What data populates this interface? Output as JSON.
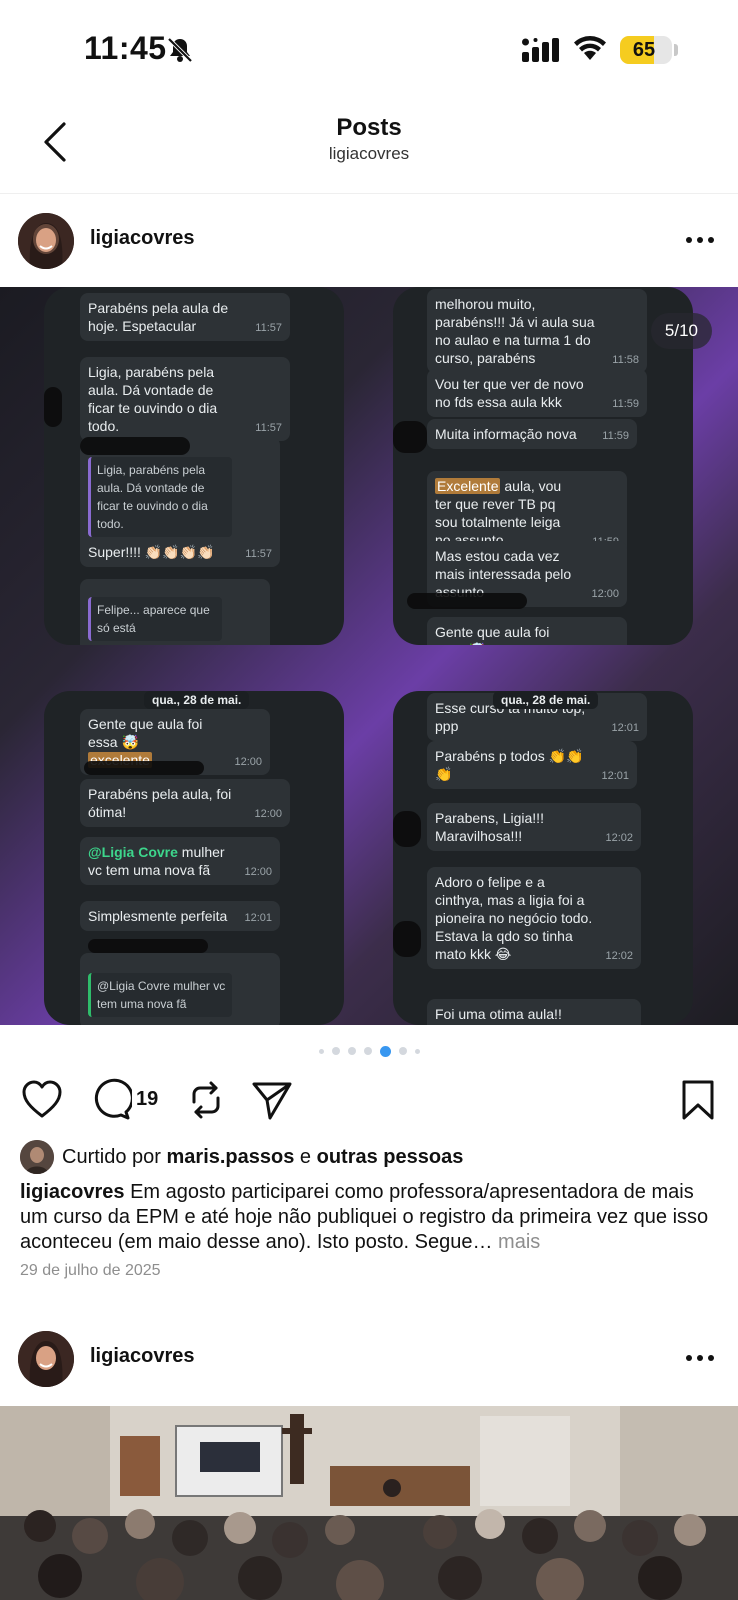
{
  "status_bar": {
    "time": "11:45",
    "battery": "65",
    "battery_level": 0.65
  },
  "header": {
    "title": "Posts",
    "subtitle": "ligiacovres"
  },
  "post1": {
    "username": "ligiacovres",
    "counter": "5/10",
    "chat": {
      "p1": {
        "b1": "Parabéns pela aula de hoje. Espetacular",
        "b1_time": "11:57",
        "b2": "Ligia, parabéns pela aula. Dá vontade de ficar te ouvindo o dia todo.",
        "b2_time": "11:57",
        "b3_quote": "Ligia, parabéns pela aula. Dá vontade de ficar te ouvindo o dia todo.",
        "b3": "Super!!!! 👏🏻👏🏻👏🏻👏🏻",
        "b3_time": "11:57",
        "b4_quote": "Felipe... aparece que só está"
      },
      "p2": {
        "b1": "melhorou muito, parabéns!!! Já vi aula sua no aulao e na turma 1 do curso, parabéns",
        "b1_time": "11:58",
        "b2": "Vou ter que ver de novo no fds essa aula kkk",
        "b2_time": "11:59",
        "b3": "Muita informação nova",
        "b3_time": "11:59",
        "b4_hl": "Excelente",
        "b4": " aula, vou ter que rever TB pq sou totalmente leiga no assunto",
        "b4_time": "11:59",
        "b5": "Mas estou cada vez mais interessada pelo assunto",
        "b5_time": "12:00",
        "b6": "Gente que aula foi essa 🤯"
      },
      "p3": {
        "date": "qua., 28 de mai.",
        "b1": "Gente que aula foi essa 🤯",
        "b1_hl": "excelente",
        "b1_time": "12:00",
        "b2": "Parabéns pela aula, foi ótima!",
        "b2_time": "12:00",
        "b3_mention": "@Ligia Covre",
        "b3": " mulher vc tem uma nova fã",
        "b3_time": "12:00",
        "b4": "Simplesmente perfeita",
        "b4_time": "12:01",
        "b5_quote": "@Ligia Covre mulher vc tem uma nova fã"
      },
      "p4": {
        "date": "qua., 28 de mai.",
        "b1": "Esse curso tá muito top, ppp",
        "b1_time": "12:01",
        "b2": "Parabéns p todos 👏👏👏",
        "b2_time": "12:01",
        "b3": "Parabens, Ligia!!! Maravilhosa!!!",
        "b3_time": "12:02",
        "b4": "Adoro o felipe e a cinthya, mas a ligia foi a pioneira no negócio todo. Estava la qdo so tinha mato kkk 😂",
        "b4_time": "12:02",
        "b5": "Foi uma otima aula!! adorei."
      }
    },
    "comment_count": "19",
    "likes": {
      "prefix": "Curtido por ",
      "user": "maris.passos",
      "mid": " e ",
      "others": "outras pessoas"
    },
    "caption": {
      "user": "ligiacovres",
      "text": " Em agosto participarei como professora/apresentadora de mais um curso da EPM e até hoje não publiquei o registro da primeira vez que isso aconteceu (em maio desse ano). Isto posto. Segue… ",
      "more": "mais"
    },
    "date": "29 de julho de 2025"
  },
  "post2": {
    "username": "ligiacovres"
  },
  "colors": {
    "accent": "#3897f0",
    "battery": "#f5cc1f"
  }
}
